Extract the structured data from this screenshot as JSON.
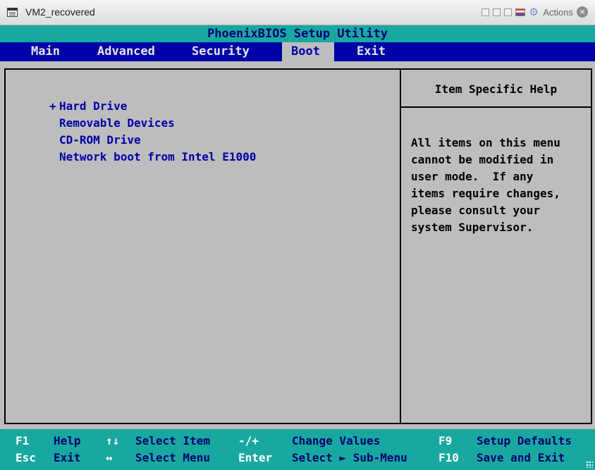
{
  "window": {
    "title": "VM2_recovered",
    "actions_label": "Actions",
    "gear_icon": "gear-icon",
    "close_icon": "close-icon",
    "close_glyph": "×"
  },
  "bios": {
    "header": "PhoenixBIOS Setup Utility",
    "tabs": [
      {
        "label": "Main",
        "active": false
      },
      {
        "label": "Advanced",
        "active": false
      },
      {
        "label": "Security",
        "active": false
      },
      {
        "label": "Boot",
        "active": true
      },
      {
        "label": "Exit",
        "active": false
      }
    ],
    "boot_items": [
      {
        "label": "Hard Drive",
        "expandable": true,
        "marker": "+"
      },
      {
        "label": "Removable Devices",
        "expandable": false
      },
      {
        "label": "CD-ROM Drive",
        "expandable": false
      },
      {
        "label": "Network boot from Intel E1000",
        "expandable": false
      }
    ],
    "help": {
      "title": "Item Specific Help",
      "lines": [
        "All items on this menu",
        "cannot be modified in",
        "user mode.  If any",
        "items require changes,",
        "please consult your",
        "system Supervisor."
      ]
    },
    "footer": {
      "row1": [
        {
          "key": "F1",
          "desc": "Help"
        },
        {
          "key": "↑↓",
          "desc": "Select Item"
        },
        {
          "key": "-/+",
          "desc": "Change Values"
        },
        {
          "key": "F9",
          "desc": "Setup Defaults"
        }
      ],
      "row2": [
        {
          "key": "Esc",
          "desc": "Exit"
        },
        {
          "key": "↔",
          "desc": "Select Menu"
        },
        {
          "key": "Enter",
          "desc": "Select ► Sub-Menu"
        },
        {
          "key": "F10",
          "desc": "Save and Exit"
        }
      ]
    },
    "colors": {
      "menu_bar": "#0000a8",
      "header": "#18a8a0",
      "screen": "#bdbdbd"
    }
  }
}
